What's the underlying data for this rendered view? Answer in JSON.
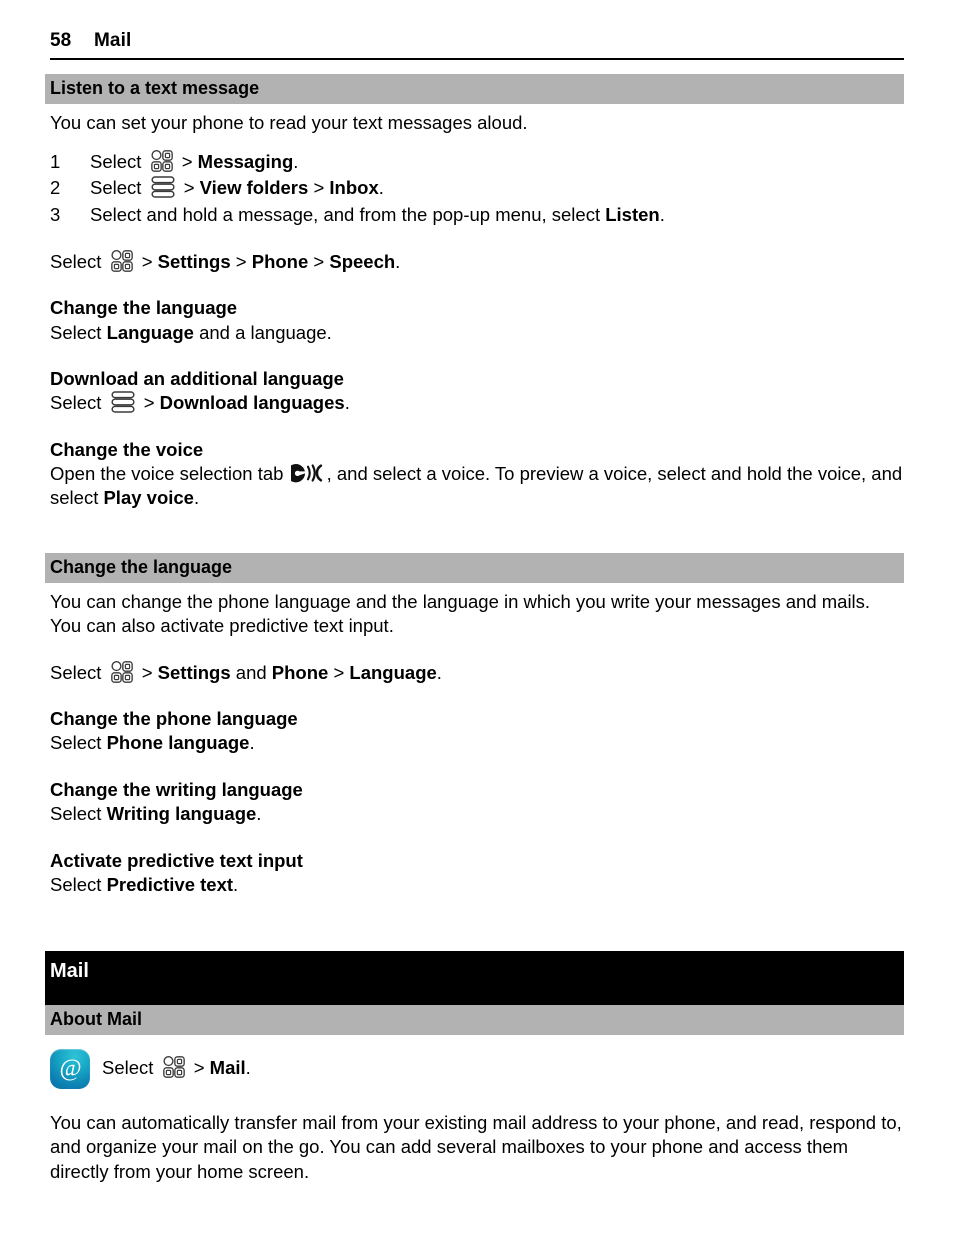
{
  "header": {
    "page_number": "58",
    "chapter": "Mail"
  },
  "icons": {
    "menu_grid": "menu-grid-icon",
    "options_list": "options-list-icon",
    "voice_tab": "voice-selection-icon",
    "mail_app": "mail-app-icon"
  },
  "colors": {
    "band_gray": "#b2b2b2",
    "band_black": "#000000",
    "mail_icon_accent": "#16a5c4",
    "text": "#000000"
  },
  "sections": {
    "listen": {
      "heading": "Listen to a text message",
      "intro": "You can set your phone to read your text messages aloud.",
      "steps": [
        {
          "num": "1",
          "lead": "Select",
          "sep": ">",
          "target": "Messaging",
          "tail": "."
        },
        {
          "num": "2",
          "lead": "Select",
          "sep": ">",
          "target": "View folders",
          "sep2": ">",
          "target2": "Inbox",
          "tail": "."
        },
        {
          "num": "3",
          "full_lead": "Select and hold a message, and from the pop-up menu, select",
          "target": "Listen",
          "tail": "."
        }
      ],
      "path_line": {
        "lead": "Select",
        "sep1": ">",
        "item1": "Settings",
        "sep2": ">",
        "item2": "Phone",
        "sep3": ">",
        "item3": "Speech",
        "tail": "."
      },
      "change_language": {
        "heading": "Change the language",
        "lead": "Select",
        "target": "Language",
        "tail": " and a language."
      },
      "download_language": {
        "heading": "Download an additional language",
        "lead": "Select",
        "sep": ">",
        "target": "Download languages",
        "tail": "."
      },
      "change_voice": {
        "heading": "Change the voice",
        "text_before": "Open the voice selection tab",
        "text_middle": ", and select a voice. To preview a voice, select and hold the voice, and select",
        "target": "Play voice",
        "tail": "."
      }
    },
    "change_language": {
      "heading": "Change the language",
      "intro": "You can change the phone language and the language in which you write your messages and mails. You can also activate predictive text input.",
      "path_line": {
        "lead": "Select",
        "sep1": ">",
        "item1": "Settings",
        "conj": "and",
        "item2": "Phone",
        "sep2": ">",
        "item3": "Language",
        "tail": "."
      },
      "subsections": [
        {
          "heading": "Change the phone language",
          "lead": "Select",
          "target": "Phone language",
          "tail": "."
        },
        {
          "heading": "Change the writing language",
          "lead": "Select",
          "target": "Writing language",
          "tail": "."
        },
        {
          "heading": "Activate predictive text input",
          "lead": "Select",
          "target": "Predictive text",
          "tail": "."
        }
      ]
    },
    "mail": {
      "chapter_title": "Mail",
      "heading": "About Mail",
      "path_line": {
        "lead": "Select",
        "sep": ">",
        "target": "Mail",
        "tail": "."
      },
      "body": "You can automatically transfer mail from your existing mail address to your phone, and read, respond to, and organize your mail on the go. You can add several mailboxes to your phone and access them directly from your home screen."
    }
  }
}
